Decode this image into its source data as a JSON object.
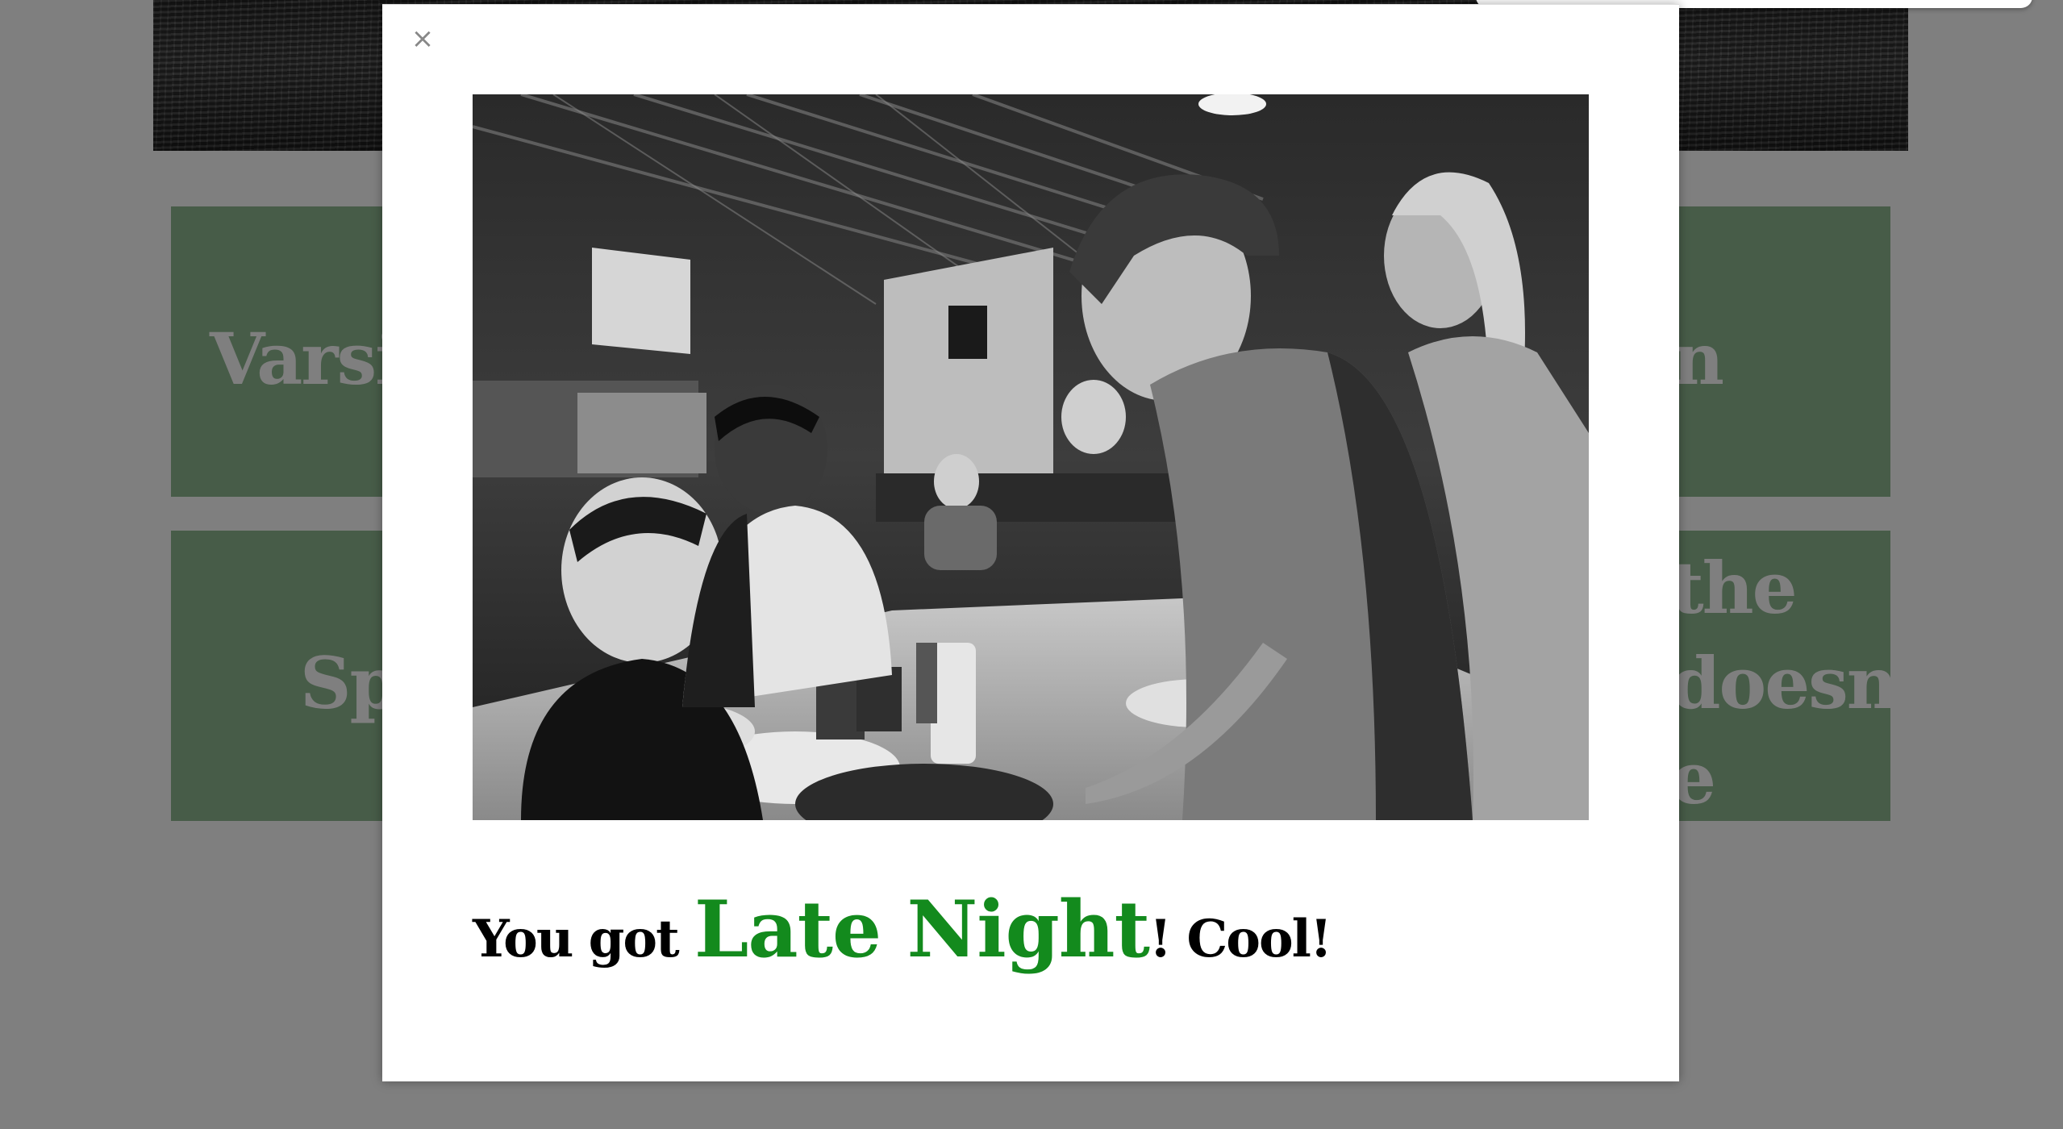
{
  "background": {
    "tiles": [
      {
        "line1": "Varsi",
        "line1_right": "n"
      },
      {
        "line1_right": "the",
        "line2_left": "Sp",
        "line2_right": "doesn't",
        "line3_right": "e"
      }
    ],
    "tile_color": "#8fb891"
  },
  "modal": {
    "close_label": "×",
    "photo_alt": "Black and white photo of teens eating hot dogs at a long table in a large hall",
    "result": {
      "prefix": "You got ",
      "highlight": "Late Night",
      "suffix": "! Cool!"
    },
    "highlight_color": "#138a1d"
  }
}
